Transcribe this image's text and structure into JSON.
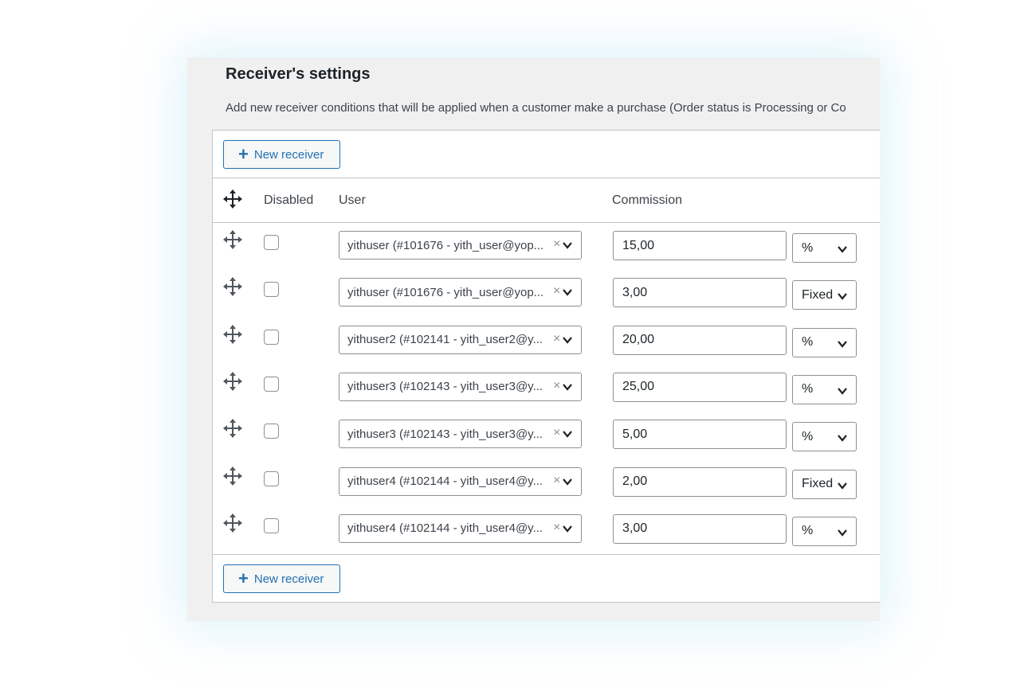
{
  "settings": {
    "title": "Receiver's settings",
    "description": "Add new receiver conditions that will be applied when a customer make a purchase (Order status is Processing or Co"
  },
  "buttons": {
    "new_receiver": "New receiver"
  },
  "table": {
    "headers": {
      "disabled": "Disabled",
      "user": "User",
      "commission": "Commission"
    },
    "rows": [
      {
        "user": "yithuser (#101676 - yith_user@yop...",
        "commission": "15,00",
        "type": "%",
        "disabled": false
      },
      {
        "user": "yithuser (#101676 - yith_user@yop...",
        "commission": "3,00",
        "type": "Fixed",
        "disabled": false
      },
      {
        "user": "yithuser2 (#102141 - yith_user2@y...",
        "commission": "20,00",
        "type": "%",
        "disabled": false
      },
      {
        "user": "yithuser3 (#102143 - yith_user3@y...",
        "commission": "25,00",
        "type": "%",
        "disabled": false
      },
      {
        "user": "yithuser3 (#102143 - yith_user3@y...",
        "commission": "5,00",
        "type": "%",
        "disabled": false
      },
      {
        "user": "yithuser4 (#102144 - yith_user4@y...",
        "commission": "2,00",
        "type": "Fixed",
        "disabled": false
      },
      {
        "user": "yithuser4 (#102144 - yith_user4@y...",
        "commission": "3,00",
        "type": "%",
        "disabled": false
      }
    ]
  },
  "icons": {
    "move": "move-icon",
    "add": "plus-icon",
    "clear": "clear-icon",
    "dropdown": "chevron-down-icon"
  },
  "colors": {
    "accent": "#2271b1",
    "panel_bg": "#f0f0f1",
    "border": "#8c8f94"
  }
}
